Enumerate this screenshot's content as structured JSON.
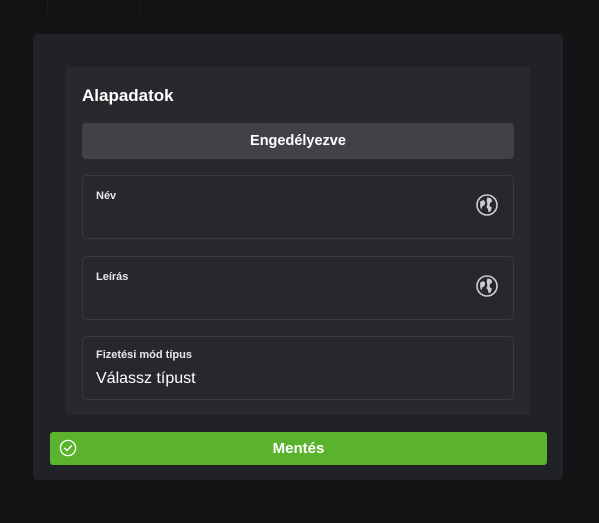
{
  "section": {
    "title": "Alapadatok",
    "toggle_label": "Engedélyezve"
  },
  "fields": {
    "name": {
      "label": "Név",
      "value": ""
    },
    "description": {
      "label": "Leírás",
      "value": ""
    },
    "payment_type": {
      "label": "Fizetési mód típus",
      "value": "Válassz típust"
    }
  },
  "icons": {
    "translate": "globe-icon",
    "save": "check-circle-icon"
  },
  "actions": {
    "save_label": "Mentés"
  },
  "colors": {
    "save_button": "#5bb32d",
    "toggle_bg": "#414247",
    "card_bg": "#28292d"
  }
}
